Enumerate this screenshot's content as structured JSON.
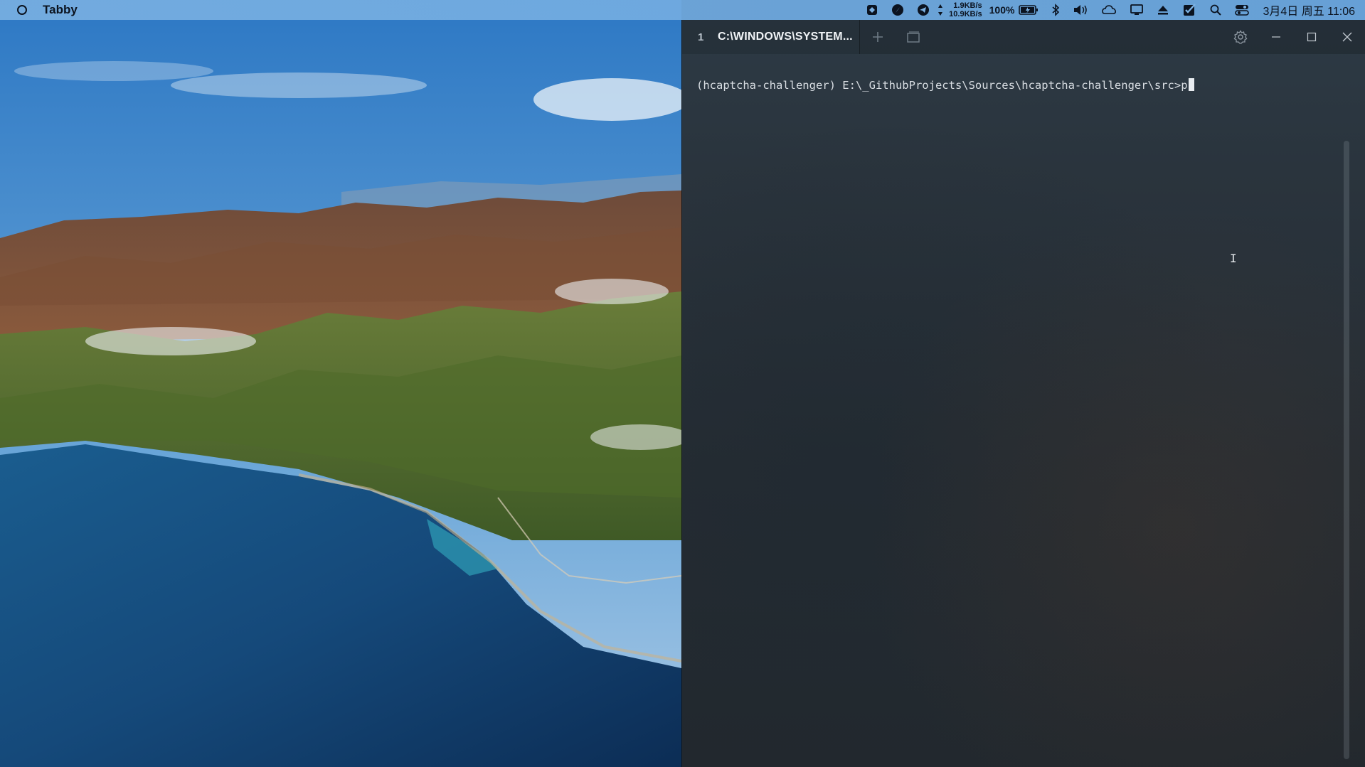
{
  "menubar": {
    "app_name": "Tabby",
    "net_up": "1.9KB/s",
    "net_down": "10.9KB/s",
    "battery_percent": "100%",
    "clock": "3月4日 周五 11:06"
  },
  "tabby": {
    "tab_number": "1",
    "tab_title": "C:\\WINDOWS\\SYSTEM...",
    "terminal_prompt": "(hcaptcha-challenger) E:\\_GithubProjects\\Sources\\hcaptcha-challenger\\src>",
    "terminal_input": "p"
  },
  "icons": {
    "apple": "apple-logo-icon",
    "tray": [
      "bug-report-icon",
      "compass-icon",
      "telegram-icon",
      "network-arrows-icon",
      "battery-icon",
      "bluetooth-icon",
      "volume-icon",
      "cloud-icon",
      "display-icon",
      "eject-icon",
      "checkbox-icon",
      "search-icon",
      "control-center-icon"
    ],
    "titlebar": [
      "new-tab-plus-icon",
      "new-window-icon",
      "settings-gear-icon",
      "minimize-icon",
      "maximize-icon",
      "close-icon"
    ]
  },
  "colors": {
    "menubar_bg": "#7db2e3",
    "terminal_bg": "#27313a",
    "terminal_text": "#d9dee3"
  }
}
